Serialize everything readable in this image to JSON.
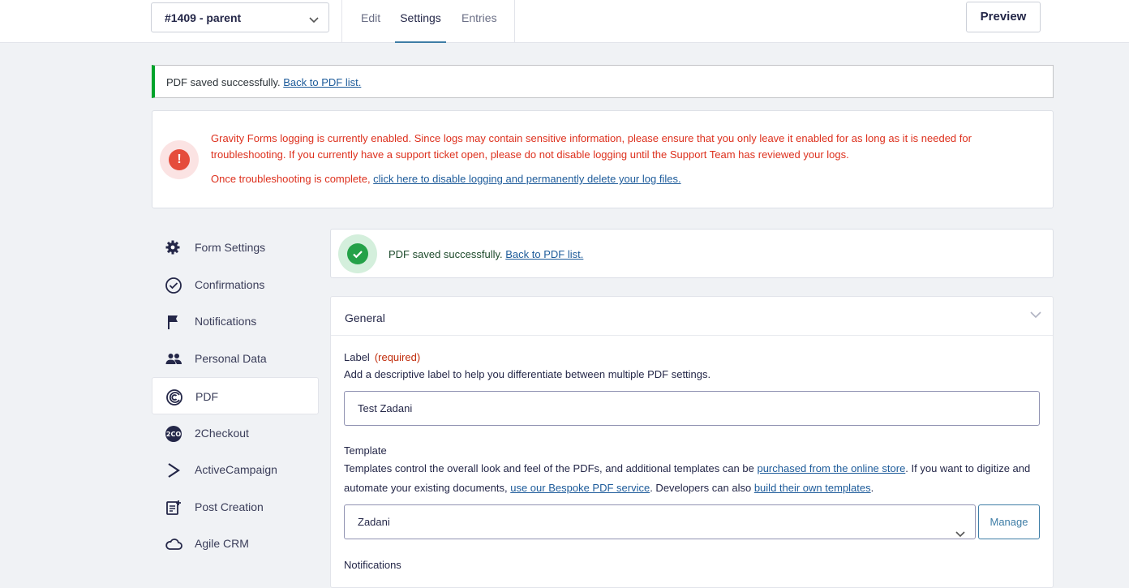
{
  "header": {
    "form_selector": "#1409 - parent",
    "tabs": [
      {
        "label": "Edit"
      },
      {
        "label": "Settings"
      },
      {
        "label": "Entries"
      }
    ],
    "preview_label": "Preview"
  },
  "notice_saved": {
    "text": "PDF saved successfully. ",
    "link": "Back to PDF list."
  },
  "logging_notice": {
    "line1": "Gravity Forms logging is currently enabled. Since logs may contain sensitive information, please ensure that you only leave it enabled for as long as it is needed for troubleshooting. ",
    "line1_strong": "If you currently have a support ticket open, please do not disable logging until the Support Team has reviewed your logs.",
    "line3_text": "Once troubleshooting is complete, ",
    "line3_link": "click here to disable logging and permanently delete your log files."
  },
  "sidebar": {
    "items": [
      {
        "label": "Form Settings",
        "icon": "gear-icon"
      },
      {
        "label": "Confirmations",
        "icon": "check-circle-icon"
      },
      {
        "label": "Notifications",
        "icon": "flag-icon"
      },
      {
        "label": "Personal Data",
        "icon": "users-icon"
      },
      {
        "label": "PDF",
        "icon": "pdf-logo-icon"
      },
      {
        "label": "2Checkout",
        "icon": "2checkout-icon"
      },
      {
        "label": "ActiveCampaign",
        "icon": "activecampaign-icon"
      },
      {
        "label": "Post Creation",
        "icon": "post-creation-icon"
      },
      {
        "label": "Agile CRM",
        "icon": "cloud-icon"
      }
    ],
    "badge_2co": "2CO"
  },
  "success_box": {
    "text": "PDF saved successfully. ",
    "link": "Back to PDF list."
  },
  "general_panel": {
    "title": "General",
    "label_field": {
      "label": "Label",
      "required": "(required)",
      "description": "Add a descriptive label to help you differentiate between multiple PDF settings.",
      "value": "Test Zadani"
    },
    "template_field": {
      "label": "Template",
      "desc_part1": "Templates control the overall look and feel of the PDFs, and additional templates can be ",
      "link1": "purchased from the online store",
      "desc_part2": ". If you want to digitize and automate your existing documents, ",
      "link2": "use our Bespoke PDF service",
      "desc_part3": ". Developers can also ",
      "link3": "build their own templates",
      "desc_part4": ".",
      "value": "Zadani",
      "manage_label": "Manage"
    },
    "next_field_label": "Notifications"
  },
  "colors": {
    "accent": "#3e7da6",
    "error": "#dd301d",
    "success": "#24a148"
  }
}
